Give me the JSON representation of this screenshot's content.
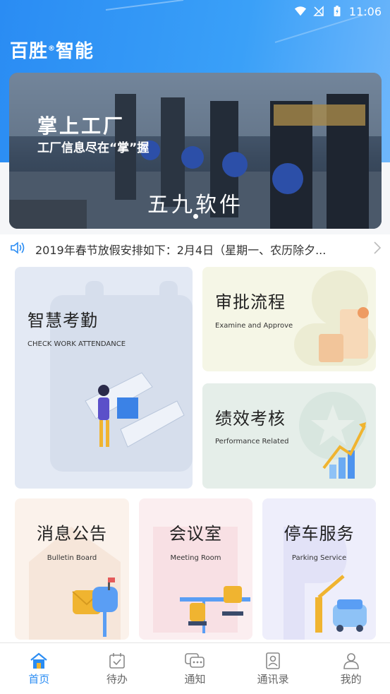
{
  "status_bar": {
    "time": "11:06",
    "icons": [
      "wifi-icon",
      "no-signal-icon",
      "battery-charging-icon"
    ]
  },
  "header": {
    "logo": "百胜",
    "logo_mark": "®",
    "logo_suffix": "智能"
  },
  "banner": {
    "title": "掌上工厂",
    "subtitle": "工厂信息尽在“掌”握",
    "brand": "五九软件",
    "page_count": 1,
    "active_page": 1
  },
  "notice": {
    "icon": "speaker-icon",
    "text": "2019年春节放假安排如下：2月4日（星期一、农历除夕...",
    "arrow": "chevron-right-icon"
  },
  "cards": {
    "attendance": {
      "title": "智慧考勤",
      "subtitle": "CHECK WORK ATTENDANCE"
    },
    "approve": {
      "title": "审批流程",
      "subtitle": "Examine and Approve"
    },
    "performance": {
      "title": "绩效考核",
      "subtitle": "Performance Related"
    },
    "bulletin": {
      "title": "消息公告",
      "subtitle": "Bulletin Board"
    },
    "meeting": {
      "title": "会议室",
      "subtitle": "Meeting Room"
    },
    "parking": {
      "title": "停车服务",
      "subtitle": "Parking Service"
    }
  },
  "tabbar": {
    "items": [
      {
        "label": "首页",
        "icon": "home-icon",
        "active": true
      },
      {
        "label": "待办",
        "icon": "calendar-check-icon",
        "active": false
      },
      {
        "label": "通知",
        "icon": "chat-bubble-icon",
        "active": false
      },
      {
        "label": "通讯录",
        "icon": "contacts-icon",
        "active": false
      },
      {
        "label": "我的",
        "icon": "user-icon",
        "active": false
      }
    ]
  },
  "colors": {
    "accent": "#2a8cf3",
    "header": "#3aa0f8"
  }
}
